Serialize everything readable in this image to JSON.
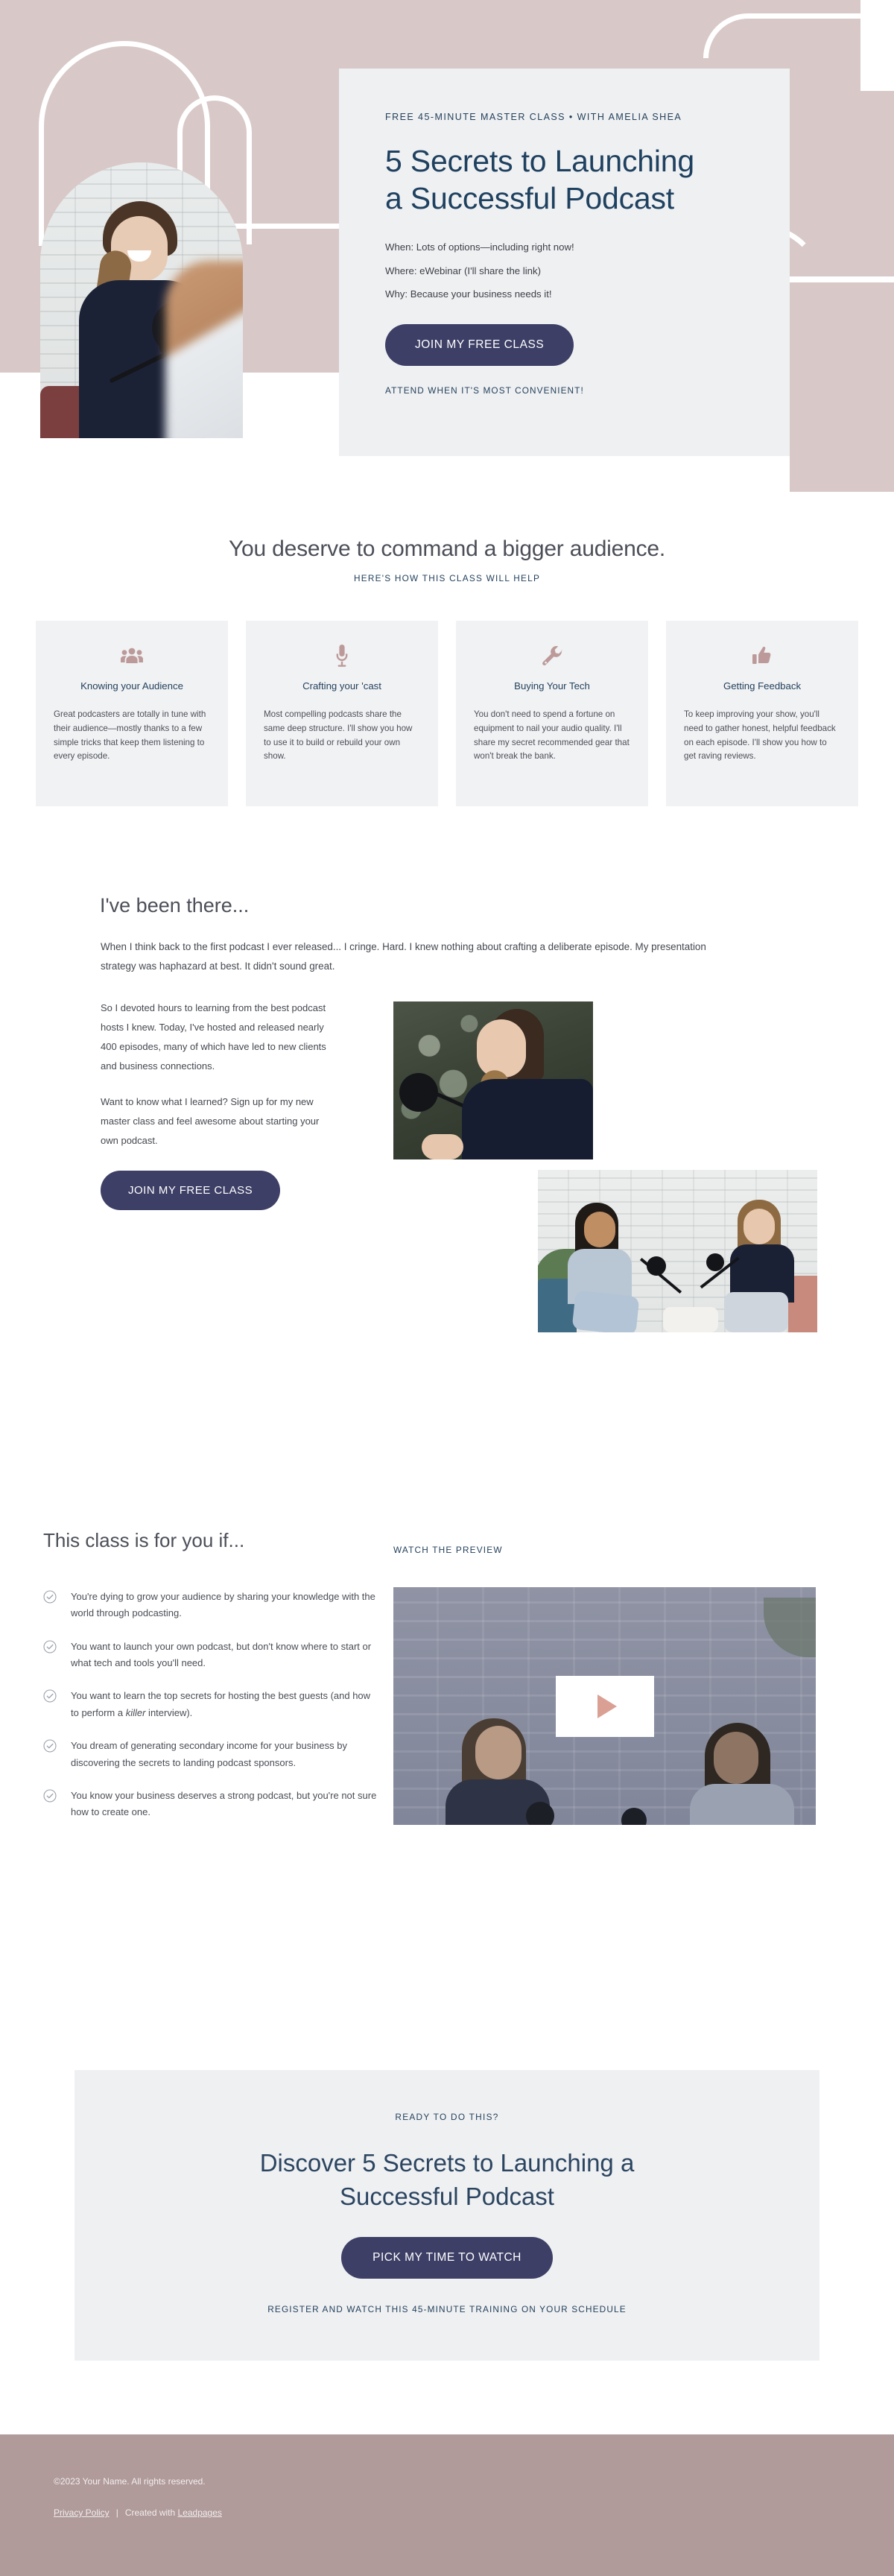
{
  "colors": {
    "pink_bg": "#d8c9c8",
    "card_bg": "#eff0f2",
    "navy_button": "#3d3f66",
    "heading_blue": "#1f4160",
    "icon_rose": "#bd9a9a",
    "footer_pink": "#b09a9a",
    "play_triangle": "#dba094"
  },
  "hero": {
    "eyebrow": "FREE 45-MINUTE MASTER CLASS • WITH AMELIA SHEA",
    "title_line1": "5 Secrets to Launching",
    "title_line2": "a Successful Podcast",
    "meta": [
      "When: Lots of options—including right now!",
      "Where: eWebinar (I'll share the link)",
      "Why: Because your business needs it!"
    ],
    "cta_label": "JOIN MY FREE CLASS",
    "footnote": "ATTEND WHEN IT'S MOST CONVENIENT!",
    "photo_alt": "woman-laughing-at-podcast-microphone"
  },
  "benefits": {
    "title": "You deserve to command a bigger audience.",
    "subtitle": "HERE'S HOW THIS CLASS WILL HELP",
    "cards": [
      {
        "icon": "users-group-icon",
        "title": "Knowing your Audience",
        "body": "Great podcasters are totally in tune with their audience—mostly thanks to a few simple tricks that keep them listening to every episode."
      },
      {
        "icon": "microphone-icon",
        "title": "Crafting your 'cast",
        "body": "Most compelling podcasts share the same deep structure. I'll show you how to use it to build or rebuild your own show."
      },
      {
        "icon": "wrench-icon",
        "title": "Buying Your Tech",
        "body": "You don't need to spend a fortune on equipment to nail your audio quality. I'll share my secret recommended gear that won't break the bank."
      },
      {
        "icon": "thumbs-up-icon",
        "title": "Getting Feedback",
        "body": "To keep improving your show, you'll need to gather honest, helpful feedback on each episode. I'll show you how to get raving reviews."
      }
    ]
  },
  "story": {
    "title": "I've been there...",
    "intro": "When I think back to the first podcast I ever released... I cringe. Hard. I knew nothing about crafting a deliberate episode. My presentation strategy was haphazard at best. It didn't sound great.",
    "paragraphs": [
      "So I devoted hours to learning from the best podcast hosts I knew. Today, I've hosted and released nearly 400 episodes, many of which have led to new clients and business connections.",
      "Want to know what I learned? Sign up for my new master class and feel awesome about starting your own podcast."
    ],
    "cta_label": "JOIN MY FREE CLASS",
    "image_a_alt": "woman-smiling-in-profile-with-microphone",
    "image_b_alt": "two-women-recording-podcast-in-studio"
  },
  "foryou": {
    "title": "This class is for you if...",
    "items": [
      "You're dying to grow your audience by sharing your knowledge with the world through podcasting.",
      "You want to launch your own podcast, but don't know where to start or what tech and tools you'll need.",
      "You want to learn the top secrets for hosting the best guests (and how to perform a killer interview).",
      "You dream of generating secondary income for your business by discovering the secrets to landing podcast sponsors.",
      "You know your business deserves a strong podcast, but you're not sure how to create one."
    ],
    "italic_word": "killer",
    "preview_label": "WATCH THE PREVIEW",
    "video_alt": "two-women-talking-into-podcast-microphones",
    "play_icon": "play-triangle-icon"
  },
  "cta": {
    "eyebrow": "READY TO DO THIS?",
    "title_line1": "Discover 5 Secrets to Launching a",
    "title_line2": "Successful Podcast",
    "button_label": "PICK MY TIME TO WATCH",
    "footnote": "REGISTER AND WATCH THIS 45-MINUTE TRAINING ON YOUR SCHEDULE"
  },
  "footer": {
    "copyright": "©2023 Your Name. All rights reserved.",
    "privacy_label": "Privacy Policy",
    "separator": "|",
    "created_prefix": "Created with ",
    "created_link": "Leadpages"
  }
}
